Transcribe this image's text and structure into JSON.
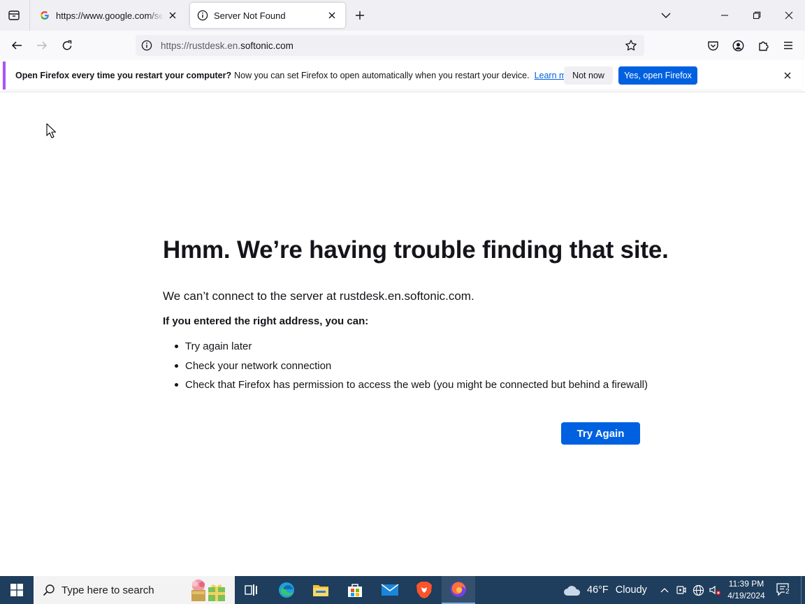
{
  "browser": {
    "tabs": [
      {
        "title": "https://www.google.com/search?q=rustdesk",
        "favicon": "google-g-icon",
        "active": false
      },
      {
        "title": "Server Not Found",
        "favicon": "info-icon",
        "active": true
      }
    ],
    "url": {
      "prefix": "https://rustdesk.en.",
      "domain": "softonic.com"
    }
  },
  "notification": {
    "lead": "Open Firefox every time you restart your computer?",
    "message": "Now you can set Firefox to open automatically when you restart your device.",
    "learn_more": "Learn more",
    "not_now": "Not now",
    "yes": "Yes, open Firefox",
    "accent": "#a855f7"
  },
  "error": {
    "title": "Hmm. We’re having trouble finding that site.",
    "description": "We can’t connect to the server at rustdesk.en.softonic.com.",
    "subtitle": "If you entered the right address, you can:",
    "suggestions": [
      "Try again later",
      "Check your network connection",
      "Check that Firefox has permission to access the web (you might be connected but behind a firewall)"
    ],
    "try_again": "Try Again"
  },
  "taskbar": {
    "search_placeholder": "Type here to search",
    "weather": {
      "temp": "46°F",
      "condition": "Cloudy"
    },
    "time": "11:39 PM",
    "date": "4/19/2024",
    "notification_count": "2",
    "apps": [
      "task-view-icon",
      "edge-icon",
      "file-explorer-icon",
      "microsoft-store-icon",
      "mail-icon",
      "brave-icon",
      "firefox-icon"
    ]
  },
  "colors": {
    "primary": "#0061e0",
    "taskbar": "#1f3d5c",
    "tab_strip": "#f0f0f4"
  }
}
